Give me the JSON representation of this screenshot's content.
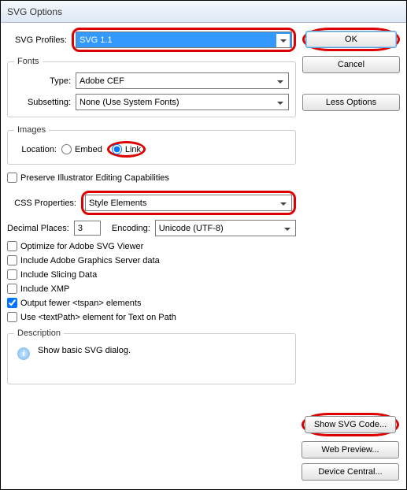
{
  "window": {
    "title": "SVG Options"
  },
  "svgProfiles": {
    "label": "SVG Profiles:",
    "value": "SVG 1.1"
  },
  "fonts": {
    "legend": "Fonts",
    "typeLabel": "Type:",
    "typeValue": "Adobe CEF",
    "subsettingLabel": "Subsetting:",
    "subsettingValue": "None (Use System Fonts)"
  },
  "images": {
    "legend": "Images",
    "locationLabel": "Location:",
    "embedLabel": "Embed",
    "linkLabel": "Link",
    "selected": "link"
  },
  "preserveLabel": "Preserve Illustrator Editing Capabilities",
  "cssProps": {
    "label": "CSS Properties:",
    "value": "Style Elements"
  },
  "decimal": {
    "label": "Decimal Places:",
    "value": "3"
  },
  "encoding": {
    "label": "Encoding:",
    "value": "Unicode (UTF-8)"
  },
  "checks": {
    "optimizeViewer": "Optimize for Adobe SVG Viewer",
    "includeGraphics": "Include Adobe Graphics Server data",
    "includeSlicing": "Include Slicing Data",
    "includeXMP": "Include XMP",
    "outputTspan": "Output fewer <tspan> elements",
    "useTextPath": "Use <textPath> element for Text on Path"
  },
  "description": {
    "legend": "Description",
    "text": "Show basic SVG dialog."
  },
  "buttons": {
    "ok": "OK",
    "cancel": "Cancel",
    "lessOptions": "Less Options",
    "showSvg": "Show SVG Code...",
    "webPreview": "Web Preview...",
    "deviceCentral": "Device Central..."
  }
}
